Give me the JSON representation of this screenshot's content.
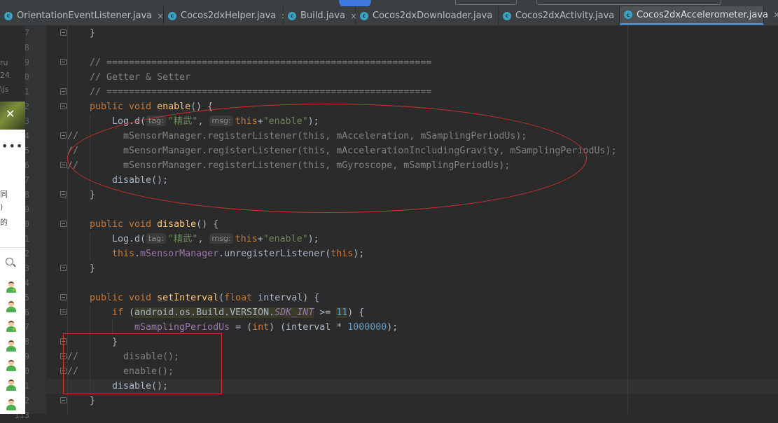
{
  "tabs": [
    {
      "name": "OrientationEventListener.java",
      "icon": "c",
      "active": false,
      "closable": true
    },
    {
      "name": "Cocos2dxHelper.java",
      "icon": "c",
      "active": false,
      "closable": true
    },
    {
      "name": "Build.java",
      "icon": "c",
      "active": false,
      "closable": true
    },
    {
      "name": "Cocos2dxDownloader.java",
      "icon": "c",
      "active": false,
      "closable": true
    },
    {
      "name": "Cocos2dxActivity.java",
      "icon": "c",
      "active": false,
      "closable": true
    },
    {
      "name": "Cocos2dxAccelerometer.java",
      "icon": "c",
      "active": true,
      "closable": true
    }
  ],
  "close_glyph": "×",
  "line_numbers": [
    "87",
    "88",
    "89",
    "90",
    "91",
    "92",
    "93",
    "94",
    "95",
    "96",
    "97",
    "98",
    "99",
    "100",
    "101",
    "102",
    "103",
    "104",
    "105",
    "106",
    "107",
    "108",
    "109",
    "110",
    "111",
    "112",
    "113"
  ],
  "editor": {
    "line_87": "}",
    "line_89": "// ==========================================================",
    "line_90": "// Getter & Setter",
    "line_91": "// ==========================================================",
    "line_92": {
      "kw": "public void ",
      "fn": "enable",
      "rest": "() {"
    },
    "line_93": {
      "pre": "Log.d(",
      "hint_tag": "tag:",
      "str1": "\"精武\"",
      "comma": ", ",
      "hint_msg": "msg:",
      "kw": "this",
      "plus": "+",
      "str2": "\"enable\"",
      "end": ");"
    },
    "line_94": {
      "marker": "//",
      "code": "mSensorManager.registerListener(this, mAcceleration, mSamplingPeriodUs);"
    },
    "line_95": {
      "marker": "//",
      "code": "mSensorManager.registerListener(this, mAccelerationIncludingGravity, mSamplingPeriodUs);"
    },
    "line_96": {
      "marker": "//",
      "code": "mSensorManager.registerListener(this, mGyroscope, mSamplingPeriodUs);"
    },
    "line_97": "disable();",
    "line_98": "}",
    "line_100": {
      "kw": "public void ",
      "fn": "disable",
      "rest": "() {"
    },
    "line_101": {
      "pre": "Log.d(",
      "hint_tag": "tag:",
      "str1": "\"精武\"",
      "comma": ", ",
      "hint_msg": "msg:",
      "kw": "this",
      "plus": "+",
      "str2": "\"enable\"",
      "end": ");"
    },
    "line_102": {
      "kw": "this",
      "dot": ".",
      "fld": "mSensorManager",
      "call": ".unregisterListener(",
      "kw2": "this",
      "end": ");"
    },
    "line_103": "}",
    "line_105": {
      "kw": "public void ",
      "fn": "setInterval",
      "paren": "(",
      "kw2": "float",
      "rest": " interval) {"
    },
    "line_106": {
      "kw": "if",
      "open": " (",
      "hl": "android.os.Build.VERSION.",
      "ital": "SDK_INT",
      "op": " >= ",
      "num": "11",
      "end": ") {"
    },
    "line_107": {
      "fld": "mSamplingPeriodUs",
      "eq": " = (",
      "kw": "int",
      "mid": ") (interval * ",
      "num": "1000000",
      "end": ");"
    },
    "line_108": "}",
    "line_109": {
      "marker": "//",
      "code": "disable();"
    },
    "line_110": {
      "marker": "//",
      "code": "enable();"
    },
    "line_111": "disable();",
    "line_112": "}"
  },
  "left_panel": {
    "top_text": [
      "ru",
      "24",
      "\\js"
    ],
    "close_glyph": "✕",
    "dots": "•••",
    "cn_text": [
      "同",
      ")",
      "的"
    ]
  },
  "colors": {
    "annotation": "#d32f2f",
    "active_tab_underline": "#4a88c7"
  }
}
